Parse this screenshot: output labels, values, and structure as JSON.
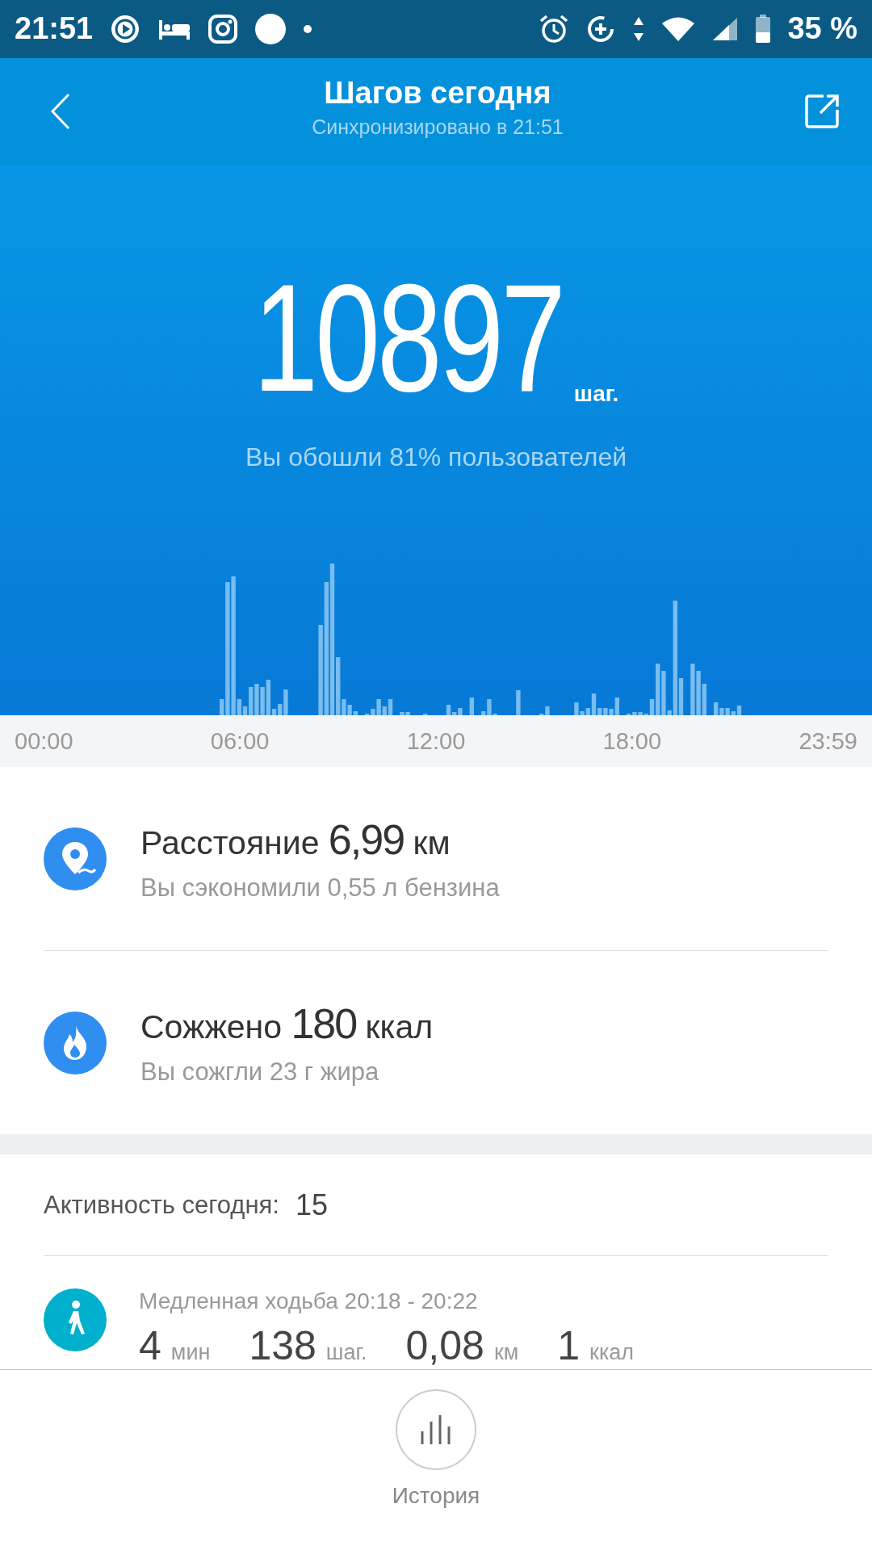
{
  "status_bar": {
    "time": "21:51",
    "battery": "35 %"
  },
  "header": {
    "title": "Шагов сегодня",
    "subtitle": "Синхронизировано в 21:51"
  },
  "steps": {
    "value": "10897",
    "unit": "шаг.",
    "comparison": "Вы обошли 81% пользователей"
  },
  "axis_labels": [
    "00:00",
    "06:00",
    "12:00",
    "18:00",
    "23:59"
  ],
  "stats": [
    {
      "kind": "distance",
      "text": "Расстояние **6,99** км",
      "note": "Вы сэкономили 0,55 л бензина"
    },
    {
      "kind": "calories",
      "text": "Сожжено **180** ккал",
      "note": "Вы сожгли 23 г жира"
    }
  ],
  "activity": {
    "label": "Активность сегодня:",
    "count": "15",
    "items": [
      {
        "kind": "walk",
        "title": "Медленная ходьба 20:18 - 20:22",
        "metrics": [
          {
            "value": "4",
            "unit": "мин"
          },
          {
            "value": "138",
            "unit": "шаг."
          },
          {
            "value": "0,08",
            "unit": "км"
          },
          {
            "value": "1",
            "unit": "ккал"
          }
        ]
      }
    ]
  },
  "nav": {
    "label": "История"
  }
}
